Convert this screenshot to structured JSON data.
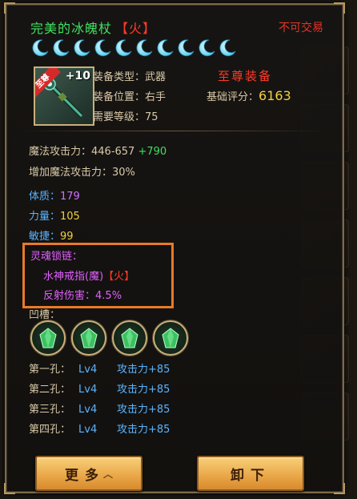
{
  "item": {
    "name": "完美的冰魄杖",
    "element": "【火】",
    "no_trade": "不可交易",
    "star_count": 10,
    "enhance": "+10",
    "badge": "至尊",
    "supreme_label": "至尊装备"
  },
  "info": {
    "type_label": "装备类型：",
    "type_value": "武器",
    "pos_label": "装备位置：",
    "pos_value": "右手",
    "level_label": "需要等级：",
    "level_value": "75",
    "score_label": "基础评分：",
    "score_value": "6163"
  },
  "stats": {
    "magic_atk_label": "魔法攻击力：",
    "magic_atk_value": "446-657",
    "magic_atk_bonus": "+790",
    "magic_pct_label": "增加魔法攻击力：",
    "magic_pct_value": "30%",
    "con_label": "体质：",
    "con_value": "179",
    "str_label": "力量：",
    "str_value": "105",
    "agi_label": "敏捷：",
    "agi_value": "99"
  },
  "soul": {
    "title": "灵魂锁链：",
    "item_name": "水神戒指(魔)",
    "item_element": "【火】",
    "effect": "反射伤害：",
    "effect_value": "4.5%"
  },
  "sockets": {
    "title": "凹槽：",
    "holes": [
      {
        "label": "第一孔：",
        "lv": "Lv4",
        "effect": "攻击力+85"
      },
      {
        "label": "第二孔：",
        "lv": "Lv4",
        "effect": "攻击力+85"
      },
      {
        "label": "第三孔：",
        "lv": "Lv4",
        "effect": "攻击力+85"
      },
      {
        "label": "第四孔：",
        "lv": "Lv4",
        "effect": "攻击力+85"
      }
    ]
  },
  "buttons": {
    "more": "更多",
    "unequip": "卸下"
  },
  "colors": {
    "name_green": "#3fe060",
    "element_red": "#ff3a2a",
    "score_gold": "#f0d040",
    "soul_purple": "#e060ff",
    "socket_blue": "#5ab4ff",
    "highlight_orange": "#e87a2a"
  },
  "icons": [
    "moon-star-icon",
    "staff-icon",
    "green-gem-icon",
    "chevron-up-icon"
  ]
}
